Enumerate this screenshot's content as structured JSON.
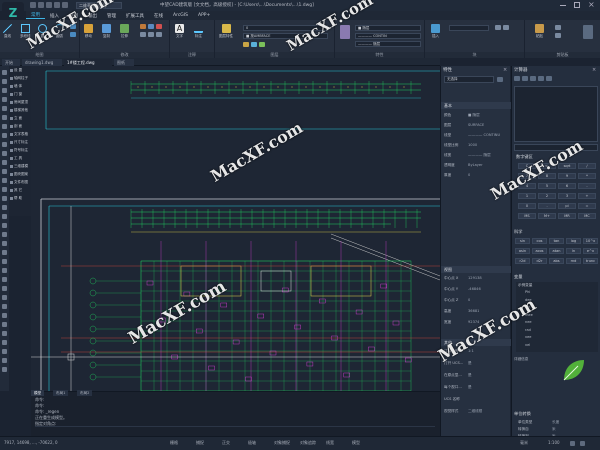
{
  "titlebar": {
    "workspace": "二维草图与注释",
    "title": "中望CAD建筑版 [文文档，高级授权] - [C:\\Users\\...\\Documents\\...\\1.dwg]",
    "min_icon": "minimize-icon",
    "max_icon": "maximize-icon",
    "close_icon": "close-icon"
  },
  "menus": [
    "常用",
    "插入",
    "视图",
    "输出",
    "管理",
    "扩展工具",
    "在线",
    "ArcGIS",
    "APP+"
  ],
  "active_menu": 0,
  "ribbon": {
    "groups": [
      "绘图",
      "修改",
      "注释",
      "图层",
      "特性",
      "块",
      "剪贴板"
    ],
    "draw_buttons": [
      "直线",
      "多段线",
      "圆",
      "圆弧"
    ],
    "modify_buttons": [
      "移动",
      "复制",
      "拉伸"
    ],
    "annot_buttons": [
      "文字",
      "标注"
    ],
    "layer_button": "图层特性",
    "layer_field": "0",
    "props_fields": [
      "■ 随层",
      "———— CONTIN",
      "———— 随层"
    ],
    "bylayer_field": "■ 按AMBFACE",
    "clipboard_button": "粘贴",
    "block_button": "插入"
  },
  "tabs": [
    "开始",
    "drawing1.dwg",
    "1#楼工程.dwg",
    "图纸"
  ],
  "active_tab": 2,
  "palette": {
    "items": [
      "设  置",
      "轴网柱子",
      "墙  体",
      "门  窗",
      "房间屋顶",
      "楼梯其他",
      "立  面",
      "剖  面",
      "文字表格",
      "尺寸标注",
      "符号标注",
      "工  具",
      "三维建模",
      "图块图案",
      "文件布图",
      "其  它",
      "帮  助"
    ]
  },
  "properties": {
    "title": "特性",
    "selection": "无选择",
    "general_header": "基本",
    "general_rows": [
      {
        "k": "颜色",
        "v": "■ 随层"
      },
      {
        "k": "图层",
        "v": "SURFACE"
      },
      {
        "k": "线型",
        "v": "———— CONTINU"
      },
      {
        "k": "线型比例",
        "v": "1000"
      },
      {
        "k": "线宽",
        "v": "———— 随层"
      },
      {
        "k": "透明度",
        "v": "ByLayer"
      },
      {
        "k": "厚度",
        "v": "0"
      }
    ],
    "view_header": "视图",
    "view_rows": [
      {
        "k": "中心点 X",
        "v": "129138"
      },
      {
        "k": "中心点 Y",
        "v": "-46846"
      },
      {
        "k": "中心点 Z",
        "v": "0"
      },
      {
        "k": "高度",
        "v": "36681"
      },
      {
        "k": "宽度",
        "v": "92374"
      }
    ],
    "misc_header": "其他",
    "misc_rows": [
      {
        "k": "注释比例",
        "v": "1:1"
      },
      {
        "k": "打开 UCS...",
        "v": "是"
      },
      {
        "k": "在原点显...",
        "v": "是"
      },
      {
        "k": "每个视口...",
        "v": "是"
      },
      {
        "k": "UCS 名称",
        "v": ""
      },
      {
        "k": "视觉样式",
        "v": "二维线框"
      }
    ]
  },
  "calculator": {
    "title": "计算器",
    "numeric_header": "数字键区",
    "numeric_keys": [
      "C",
      "<-",
      "sqrt",
      "/",
      "7",
      "8",
      "9",
      "*",
      "4",
      "5",
      "6",
      "-",
      "1",
      "2",
      "3",
      "+",
      "0",
      ".",
      "pi",
      "=",
      "MS",
      "M+",
      "MR",
      "MC"
    ],
    "science_header": "科学",
    "science_keys": [
      "sin",
      "cos",
      "tan",
      "log",
      "10^x",
      "asin",
      "acos",
      "atan",
      "ln",
      "e^x",
      "r2d",
      "d2r",
      "abs",
      "rnd",
      "trunc"
    ],
    "vars_header": "变量",
    "vars_tree_root": "示例变量",
    "vars_items": [
      "Phi",
      "dee",
      "ille",
      "mee",
      "nee",
      "rad",
      "vee",
      "vel"
    ],
    "vars_detail": "详细信息",
    "units_header": "单位转换",
    "unit_rows": [
      {
        "k": "单位类型",
        "v": "长度"
      },
      {
        "k": "转换自",
        "v": "米"
      },
      {
        "k": "转换到",
        "v": "米"
      }
    ]
  },
  "command": {
    "lines": [
      "命令:",
      "命令:",
      "命令: _regen",
      "正在重生成模型。",
      "指定对角点:"
    ],
    "model_tab": "模型",
    "layout_tabs": [
      "布局1",
      "布局2"
    ]
  },
  "status": {
    "coords": "7917, 14698, ..., -70622, 0",
    "units": "毫米",
    "scale": "1:100",
    "toggles": [
      "栅格",
      "捕捉",
      "正交",
      "极轴",
      "对象捕捉",
      "对象追踪",
      "线宽",
      "模型"
    ]
  },
  "watermark": "MacXF.com",
  "colors": {
    "accent": "#3fb6e6",
    "green_layer": "#20d060",
    "cyan": "#27c7d8",
    "magenta": "#e040e0",
    "yellow": "#e8d84a",
    "red": "#e04a3a"
  }
}
